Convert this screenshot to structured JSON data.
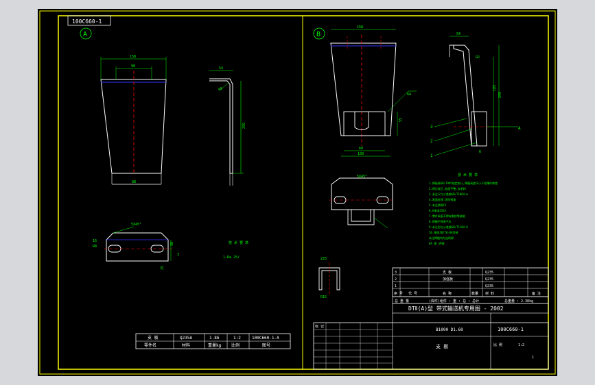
{
  "drawing_number": "100C660-1",
  "views": {
    "a_label": "A",
    "b_label": "B",
    "a": {
      "dim_width_top": "158",
      "dim_hole_spacing": "98",
      "dim_width_bottom": "88",
      "dim_height": "295",
      "dim_flange": "54",
      "dim_bend_radius": "R8",
      "dim_chamfer": "5X45°",
      "dim_slot": "16",
      "dim_slot_radius": "R8",
      "dim_side_1": "38",
      "dim_side_2": "25",
      "dim_side_3": "3"
    },
    "b": {
      "dim_width_top": "158",
      "dim_slot_width": "60",
      "dim_bottom_width": "100",
      "dim_slot_depth": "55",
      "dim_height": "295",
      "dim_side_height": "185",
      "dim_flange": "54",
      "dim_radius": "R2",
      "dim_weld": "6",
      "dim_chamfer": "5X45°",
      "dim_ref_a": "A",
      "dim_section_a": "225",
      "dim_section_b": "R15",
      "part_1": "1",
      "part_2": "2",
      "part_3": "3",
      "weld_note": "6A"
    }
  },
  "tech_notes_a": [
    "技 术 要 求",
    "1.Ra 25/"
  ],
  "tech_notes_b": {
    "title": "技 术 要 求",
    "lines": [
      "1.焊接按GB/T985规定执行,焊缝高度不小于较薄件厚度",
      "2.焊后校正,各面平整,去毛刺",
      "3.未注尺寸公差按GB/T1804-m",
      "4.表面处理:涂防锈漆",
      "5.未注倒角C1",
      "6.材料Q235A",
      "7.零件表面不得有裂纹等缺陷",
      "8.焊缝不得有气孔",
      "9.未注形位公差按GB/T1184-K",
      "10.按照JB/T8-88涂装",
      "未注焊缝均为连续焊",
      "6A 焊 SP焊"
    ]
  },
  "title_block_a": {
    "row1": [
      "支 板",
      "Q235A",
      "1.86",
      "1:2",
      "100C660-1-A"
    ],
    "row2": [
      "零件名",
      "材料",
      "重量kg",
      "比例",
      "图号"
    ]
  },
  "title_block_b": {
    "parts_rows": [
      [
        "3",
        "",
        "支 板",
        "",
        "Q235",
        "",
        ""
      ],
      [
        "2",
        "",
        "加强板",
        "",
        "Q235",
        "",
        ""
      ],
      [
        "1",
        "",
        "",
        "",
        "Q235",
        "",
        ""
      ]
    ],
    "parts_header": [
      "序 号",
      "代 号",
      "名 称",
      "数量",
      "材 料",
      "",
      "备 注"
    ],
    "weight_row": [
      "总 重 量",
      "(焊件)组件 : 重 : 总 : 总计",
      "总重量 : 2.38kg"
    ],
    "project_title": "DTⅡ(A)型 带式输送机专用图 - 2002",
    "spec": "B1000 D1.60",
    "drawing_no": "100C660-1",
    "part_name": "支 板",
    "revision_header": "标 记",
    "scale_label": "比 例",
    "scale_value": "1:2",
    "sheet": "1"
  },
  "colors": {
    "background": "#000000",
    "frame": "#ffff00",
    "geometry": "#ffffff",
    "dimension": "#00ff00",
    "center": "#ff0000",
    "hidden": "#3333ff",
    "cyan": "#00ffff",
    "magenta": "#ff00ff"
  }
}
